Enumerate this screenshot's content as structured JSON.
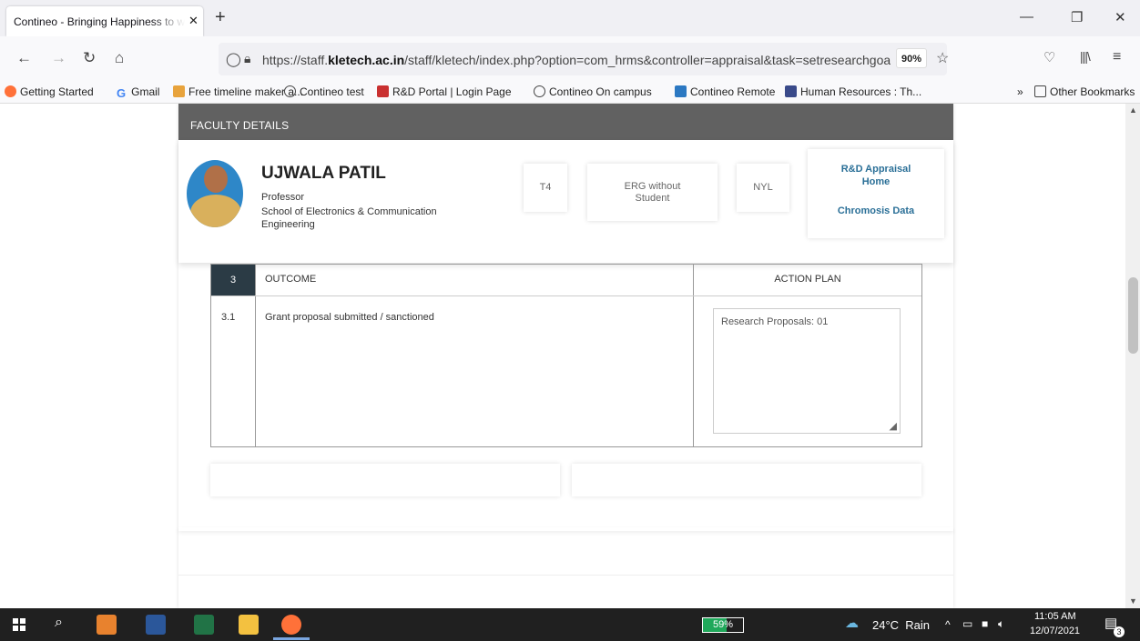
{
  "browser": {
    "tab_title": "Contineo - Bringing Happiness to w",
    "url_prefix": "https://staff.",
    "url_domain": "kletech.ac.in",
    "url_rest": "/staff/kletech/index.php?option=com_hrms&controller=appraisal&task=setresearchgoal",
    "zoom": "90%"
  },
  "bookmarks": {
    "items": [
      "Getting Started",
      "Gmail",
      "Free timeline maker a...",
      "Contineo test",
      "R&D Portal | Login Page",
      "Contineo On campus",
      "Contineo Remote",
      "Human Resources : Th..."
    ],
    "other": "Other Bookmarks"
  },
  "faculty": {
    "header": "FACULTY DETAILS",
    "name": "UJWALA PATIL",
    "designation": "Professor",
    "school_line1": "School of Electronics & Communication",
    "school_line2": "Engineering",
    "grade": "T4",
    "category_line1": "ERG without",
    "category_line2": "Student",
    "status": "NYL",
    "link_home_line1": "R&D Appraisal",
    "link_home_line2": "Home",
    "link_chromosis": "Chromosis Data"
  },
  "table": {
    "section_no": "3",
    "section_title": "OUTCOME",
    "action_header": "ACTION PLAN",
    "row_no": "3.1",
    "row_text": "Grant proposal submitted / sanctioned",
    "action_value": "Research Proposals: 01"
  },
  "taskbar": {
    "battery": "59%",
    "weather": "24°C  Rain",
    "time": "11:05 AM",
    "date": "12/07/2021",
    "notifications": "3"
  },
  "colors": {
    "header_bg": "#616161",
    "section_badge": "#2b3b45",
    "link": "#2a6f97",
    "taskbar": "#202020"
  }
}
